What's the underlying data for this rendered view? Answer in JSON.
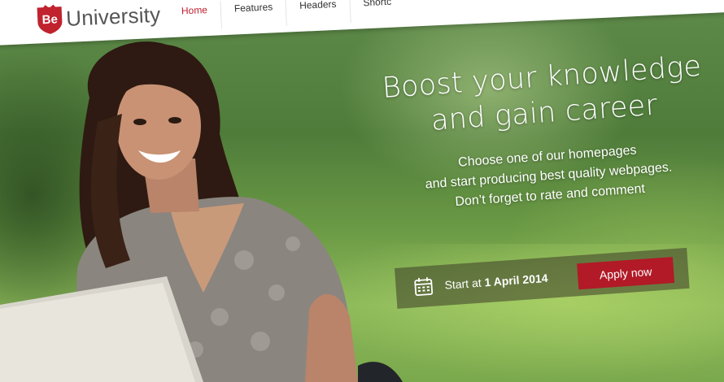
{
  "brand": {
    "logo_mark": "Be",
    "name": "University",
    "accent": "#c0222e"
  },
  "nav": {
    "items": [
      {
        "label": "Home",
        "active": true
      },
      {
        "label": "Features",
        "active": false
      },
      {
        "label": "Headers",
        "active": false
      },
      {
        "label": "Shortc",
        "active": false
      }
    ]
  },
  "hero": {
    "title_line1": "Boost your knowledge",
    "title_line2": "and gain career",
    "sub_line1": "Choose one of our homepages",
    "sub_line2": "and start producing best quality webpages.",
    "sub_line3": "Don’t forget to rate and comment"
  },
  "cta": {
    "icon": "calendar-icon",
    "start_prefix": "Start at",
    "start_date": "1 April 2014",
    "apply_label": "Apply now",
    "button_color": "#b11a26"
  }
}
